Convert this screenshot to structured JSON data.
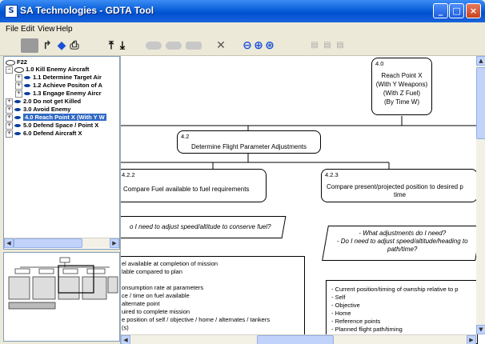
{
  "window": {
    "title": "SA Technologies - GDTA Tool"
  },
  "menu": [
    "File",
    "Edit",
    "View",
    "Help"
  ],
  "tree": {
    "root": "F22",
    "items": [
      {
        "label": "1.0 Kill Enemy Aircraft",
        "level": 1,
        "expander": "−"
      },
      {
        "label": "1.1 Determine Target Air",
        "level": 2,
        "expander": "+"
      },
      {
        "label": "1.2 Achieve Positon of A",
        "level": 2,
        "expander": "+"
      },
      {
        "label": "1.3 Engage Enemy Aircr",
        "level": 2,
        "expander": "+"
      },
      {
        "label": "2.0 Do not get Killed",
        "level": 1,
        "expander": "+"
      },
      {
        "label": "3.0 Avoid Enemy",
        "level": 1,
        "expander": "+"
      },
      {
        "label": "4.0 Reach Point X (With Y W",
        "level": 1,
        "expander": "+",
        "selected": true
      },
      {
        "label": "5.0 Defend Space / Point X",
        "level": 1,
        "expander": "+"
      },
      {
        "label": "6.0 Defend Aircraft X",
        "level": 1,
        "expander": "+"
      }
    ]
  },
  "diagram": {
    "goal": {
      "id": "4.0",
      "lines": [
        "Reach Point X",
        "(With Y Weapons)",
        "(With Z Fuel)",
        "(By Time W)"
      ]
    },
    "subgoal": {
      "id": "4.2",
      "label": "Determine Flight Parameter Adjustments"
    },
    "task_left": {
      "id": "4.2.2",
      "label": "Compare Fuel available to fuel requirements"
    },
    "task_right": {
      "id": "4.2.3",
      "label": "Compare present/projected position to desired p",
      "label2": "time"
    },
    "decision_left": "o I need to adjust speed/altitude to conserve fuel?",
    "decision_right": [
      "- What adjustments do I need?",
      "- Do I need to adjust speed/altitude/heading to",
      "path/time?"
    ],
    "req_left": [
      "el available at completion of mission",
      "lable compared to plan",
      "",
      "onsumption rate at parameters",
      "ce / time on fuel available",
      "alternate point",
      "uired to complete mission",
      "e position of self / objective / home / alternates / tankers",
      "(s)"
    ],
    "req_right": [
      "- Current position/timing of ownship relative to p",
      "- Self",
      "- Objective",
      "- Home",
      "- Reference points",
      "- Planned flight path/timing"
    ]
  }
}
